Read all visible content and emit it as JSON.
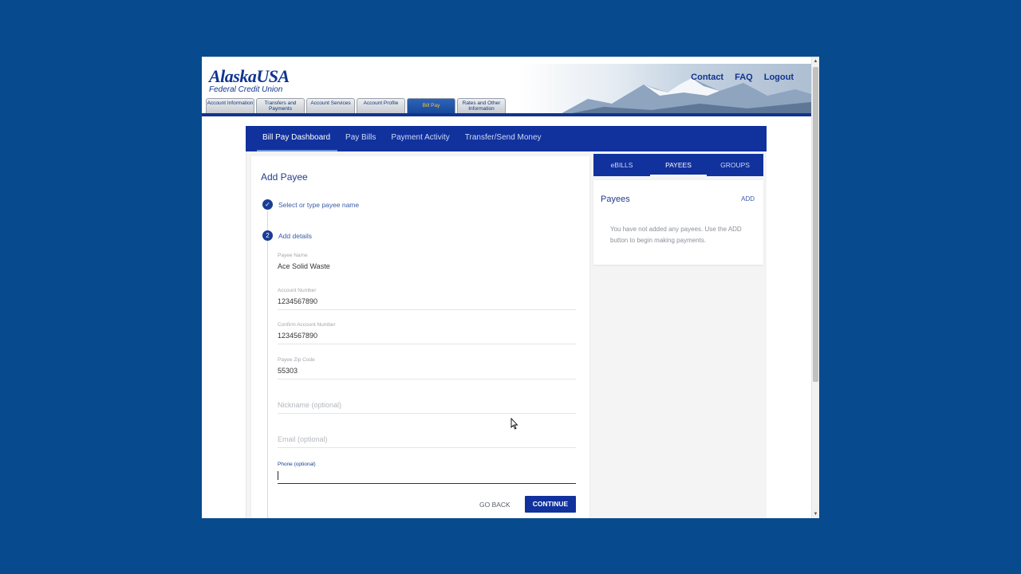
{
  "header": {
    "logo_brand": "AlaskaUSA",
    "logo_sub": "Federal Credit Union",
    "tabs": [
      {
        "label": "Account Information"
      },
      {
        "label": "Transfers and Payments"
      },
      {
        "label": "Account Services"
      },
      {
        "label": "Account Profile"
      },
      {
        "label": "Bill Pay"
      },
      {
        "label": "Rates and Other Information"
      }
    ],
    "links": {
      "contact": "Contact",
      "faq": "FAQ",
      "logout": "Logout"
    }
  },
  "billpay_nav": {
    "items": [
      {
        "label": "Bill Pay Dashboard"
      },
      {
        "label": "Pay Bills"
      },
      {
        "label": "Payment Activity"
      },
      {
        "label": "Transfer/Send Money"
      }
    ]
  },
  "add_payee": {
    "title": "Add Payee",
    "step1": {
      "label": "Select or type payee name"
    },
    "step2": {
      "number": "2",
      "label": "Add details"
    },
    "fields": {
      "payee_name": {
        "label": "Payee Name",
        "value": "Ace Solid Waste"
      },
      "account_number": {
        "label": "Account Number",
        "value": "1234567890"
      },
      "confirm_account_number": {
        "label": "Confirm Account Number",
        "value": "1234567890"
      },
      "zip": {
        "label": "Payee Zip Code",
        "value": "55303"
      },
      "nickname": {
        "placeholder": "Nickname (optional)"
      },
      "email": {
        "placeholder": "Email (optional)"
      },
      "phone": {
        "label": "Phone (optional)",
        "value": ""
      }
    },
    "go_back": "GO BACK",
    "continue": "CONTINUE"
  },
  "right_panel": {
    "tabs": [
      {
        "label": "eBILLS"
      },
      {
        "label": "PAYEES"
      },
      {
        "label": "GROUPS"
      }
    ],
    "payees": {
      "title": "Payees",
      "add": "ADD",
      "empty": "You have not added any payees. Use the ADD button to begin making payments."
    }
  },
  "colors": {
    "background": "#084a8e",
    "primary": "#11319d",
    "active_tab_text": "#f8c13a"
  }
}
